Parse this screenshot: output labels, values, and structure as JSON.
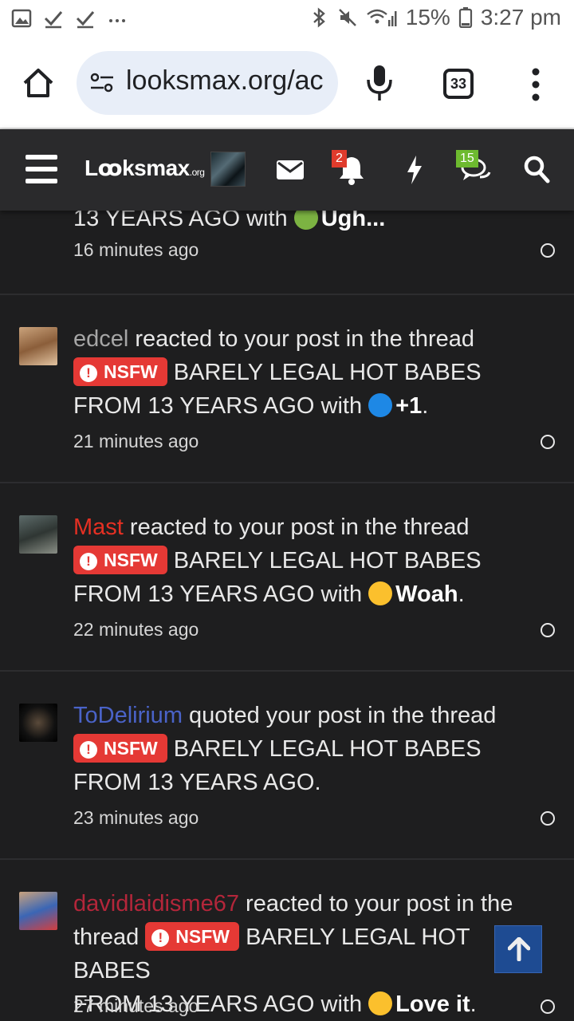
{
  "status_bar": {
    "battery": "15%",
    "time": "3:27 pm"
  },
  "browser": {
    "url": "looksmax.org/ac",
    "tab_count": "33"
  },
  "site_nav": {
    "logo_main": "Lꝏksmax",
    "logo_suffix": ".org",
    "alerts_badge": "2",
    "conversations_badge": "15"
  },
  "alerts": [
    {
      "text_partial": "13 YEARS AGO with",
      "reaction": "Ugh...",
      "time": "16 minutes ago"
    },
    {
      "user": "edcel",
      "user_color": "#a6a6a6",
      "action": "reacted to your post in the thread",
      "prefix": "NSFW",
      "thread": "BARELY LEGAL HOT BABES FROM 13 YEARS AGO",
      "with": "with",
      "reaction": "+1",
      "time": "21 minutes ago"
    },
    {
      "user": "Mast",
      "user_color": "#e53023",
      "action": "reacted to your post in the thread",
      "prefix": "NSFW",
      "thread": "BARELY LEGAL HOT BABES FROM 13 YEARS AGO",
      "with": "with",
      "reaction": "Woah",
      "time": "22 minutes ago"
    },
    {
      "user": "ToDelirium",
      "user_color": "#4a63c8",
      "action": "quoted your post in the thread",
      "prefix": "NSFW",
      "thread": "BARELY LEGAL HOT BABES FROM 13 YEARS AGO",
      "time": "23 minutes ago"
    },
    {
      "user": "davidlaidisme67",
      "user_color": "#b3263a",
      "action": "reacted to your post in the",
      "action2": "thread",
      "prefix": "NSFW",
      "thread_a": "BARELY LEGAL HOT BABES",
      "thread_b": "FROM 13 YEARS AGO",
      "with": "with",
      "reaction": "Love it",
      "time": "27 minutes ago"
    }
  ]
}
